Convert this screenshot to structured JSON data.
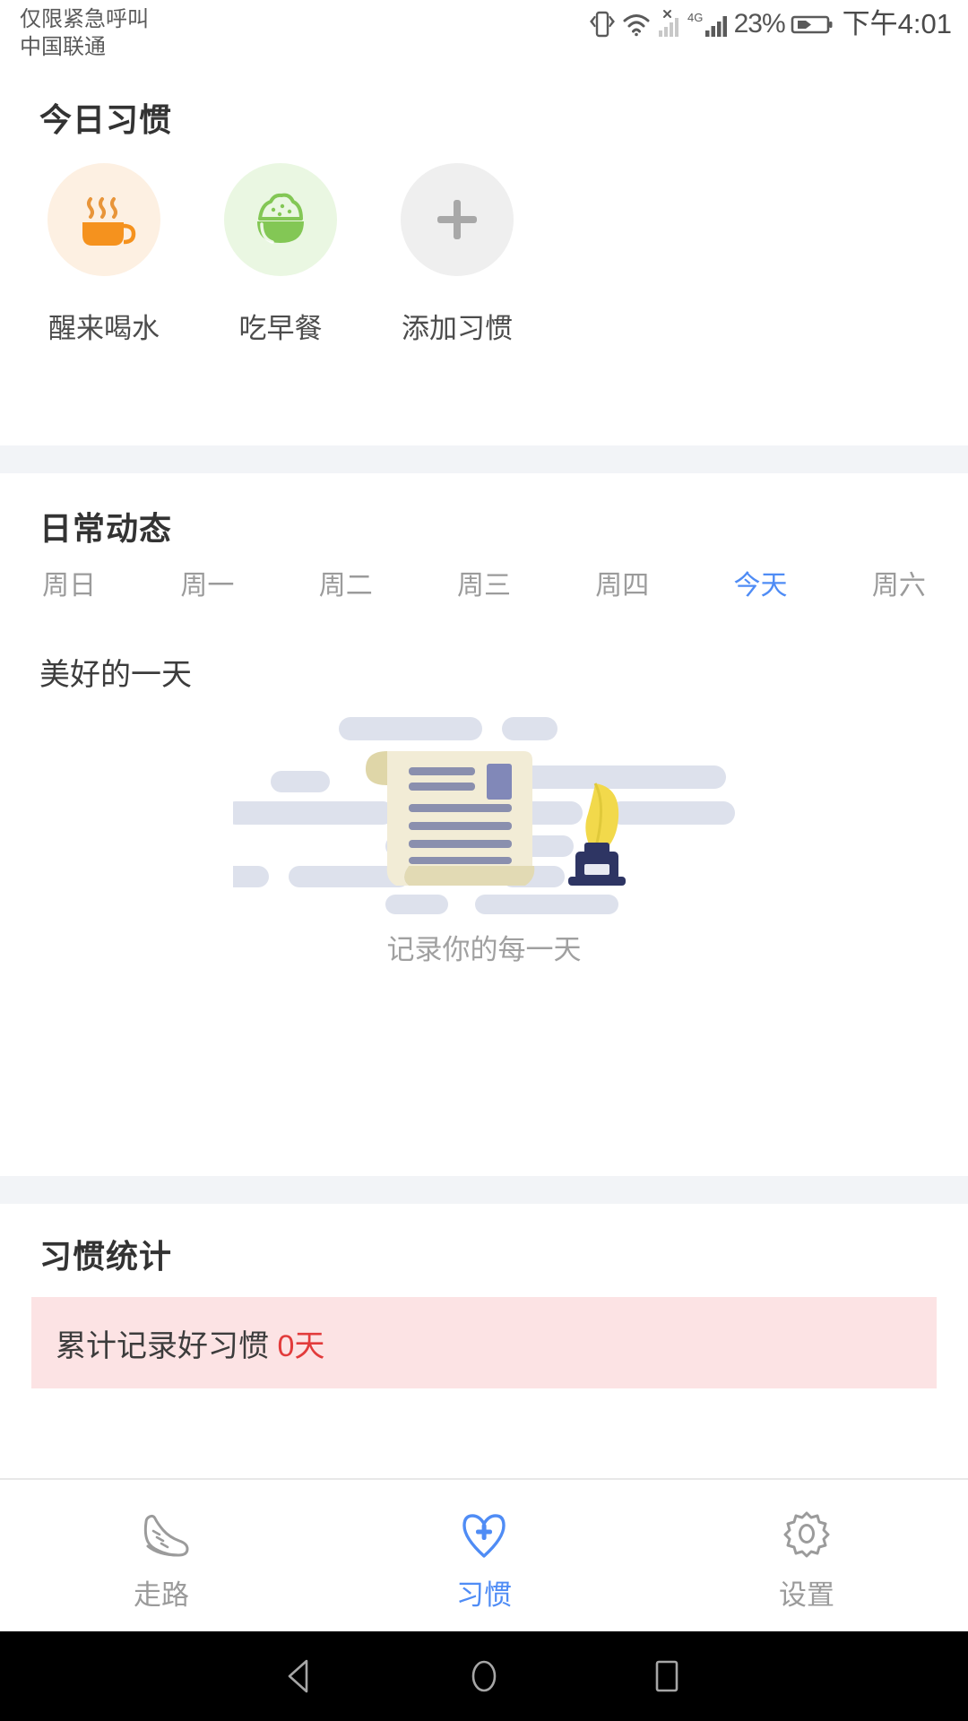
{
  "status_bar": {
    "carrier_line1": "仅限紧急呼叫",
    "carrier_line2": "中国联通",
    "vibrate_icon": "vibrate-icon",
    "wifi_icon": "wifi-icon",
    "sim1_signal_icon": "signal-no-service-icon",
    "network_type": "4G",
    "sim2_signal_icon": "signal-bars-icon",
    "battery_percent": "23%",
    "battery_icon": "battery-charging-icon",
    "time": "下午4:01"
  },
  "habits_section": {
    "title": "今日习惯",
    "items": [
      {
        "label": "醒来喝水",
        "icon": "coffee-cup-icon",
        "circle_color": "#fdf0e2",
        "icon_color": "#f5921e"
      },
      {
        "label": "吃早餐",
        "icon": "rice-bowl-icon",
        "circle_color": "#eaf7e2",
        "icon_color": "#83c755"
      },
      {
        "label": "添加习惯",
        "icon": "plus-icon",
        "circle_color": "#efefef",
        "icon_color": "#a8a8a8"
      }
    ]
  },
  "daily_section": {
    "title": "日常动态",
    "weekdays": [
      {
        "label": "周日",
        "active": false
      },
      {
        "label": "周一",
        "active": false
      },
      {
        "label": "周二",
        "active": false
      },
      {
        "label": "周三",
        "active": false
      },
      {
        "label": "周四",
        "active": false
      },
      {
        "label": "今天",
        "active": true
      },
      {
        "label": "周六",
        "active": false
      }
    ],
    "active_color": "#4f8cf5",
    "mood_label": "美好的一天",
    "empty_illustration": "scroll-quill-inkpot-illustration",
    "empty_caption": "记录你的每一天"
  },
  "stats_section": {
    "title": "习惯统计",
    "banner_prefix": "累计记录好习惯 ",
    "banner_value": "0天",
    "banner_bg": "#fce3e4",
    "banner_value_color": "#e23b3b"
  },
  "bottom_nav": {
    "items": [
      {
        "label": "走路",
        "icon": "running-shoe-icon",
        "active": false
      },
      {
        "label": "习惯",
        "icon": "heart-plus-icon",
        "active": true
      },
      {
        "label": "设置",
        "icon": "gear-icon",
        "active": false
      }
    ],
    "active_color": "#4f8cf5",
    "inactive_color": "#9b9b9b"
  },
  "android_nav": {
    "back_icon": "triangle-back-icon",
    "home_icon": "circle-home-icon",
    "recents_icon": "square-recents-icon"
  }
}
